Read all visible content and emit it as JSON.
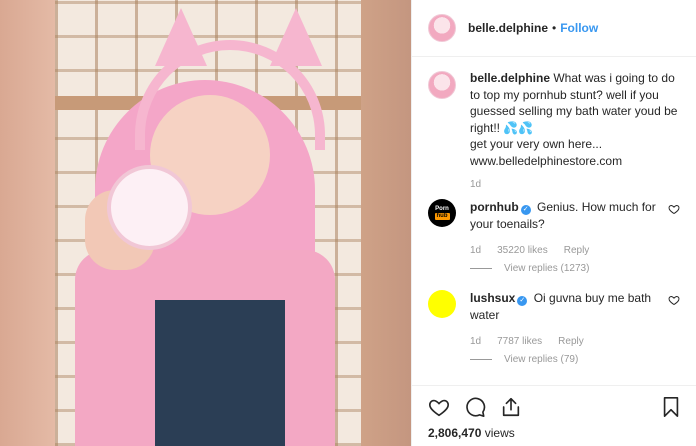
{
  "post": {
    "username": "belle.delphine",
    "separator": "•",
    "follow_label": "Follow"
  },
  "caption": {
    "username": "belle.delphine",
    "text": "What was i going to do to top my pornhub stunt? well if you guessed selling my bath water youd be right!! 💦💦\nget your very own here...\nwww.belledelphinestore.com",
    "time": "1d"
  },
  "comments": [
    {
      "username": "pornhub",
      "text": "Genius. How much for your toenails?",
      "time": "1d",
      "likes": "35220 likes",
      "reply_label": "Reply",
      "view_replies": "View replies (1273)",
      "avatar_line1": "Porn",
      "avatar_line2": "hub"
    },
    {
      "username": "lushsux",
      "text": "Oi guvna buy me bath water",
      "time": "1d",
      "likes": "7787 likes",
      "reply_label": "Reply",
      "view_replies": "View replies (79)"
    }
  ],
  "actions": {
    "views_count": "2,806,470",
    "views_label": "views"
  },
  "icons": [
    "heart-icon",
    "comment-icon",
    "share-icon",
    "bookmark-icon",
    "verified-icon"
  ],
  "colors": {
    "accent": "#3897f0",
    "text": "#262626",
    "muted": "#999999",
    "border": "#efefef",
    "avatar_yellow": "#ffff00"
  }
}
